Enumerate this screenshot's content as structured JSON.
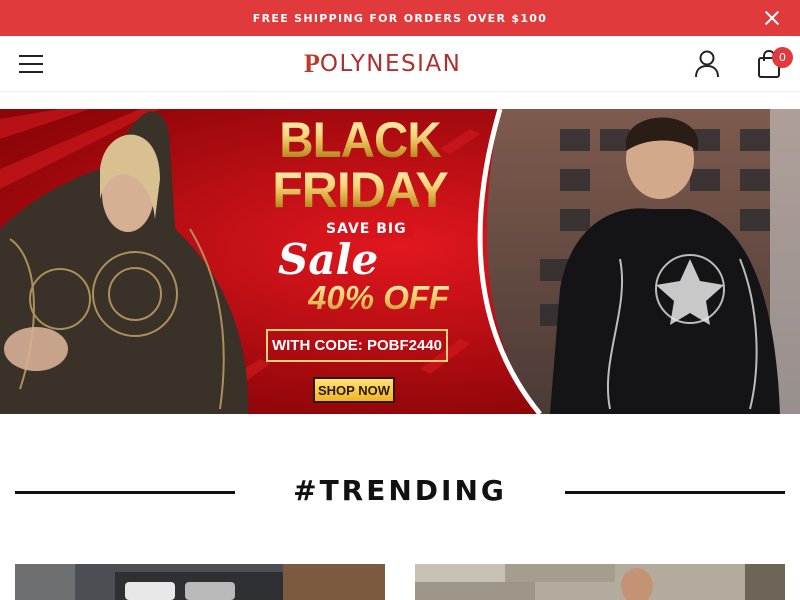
{
  "announcement": {
    "text": "FREE SHIPPING FOR ORDERS OVER $100"
  },
  "header": {
    "logo_initial": "P",
    "logo_text": "OLYNESIAN",
    "cart_count": "0"
  },
  "hero": {
    "line1": "BLACK",
    "line2": "FRIDAY",
    "save_big": "SAVE BIG",
    "sale": "Sale",
    "discount": "40% OFF",
    "code": "WITH CODE: POBF2440",
    "cta": "SHOP NOW"
  },
  "trending": {
    "title": "#TRENDING"
  },
  "colors": {
    "accent": "#e03a3c",
    "hero_red": "#b5070e",
    "gold": "#f3cc6a"
  },
  "icons": [
    "close-icon",
    "menu-icon",
    "user-icon",
    "shopping-bag-icon"
  ]
}
